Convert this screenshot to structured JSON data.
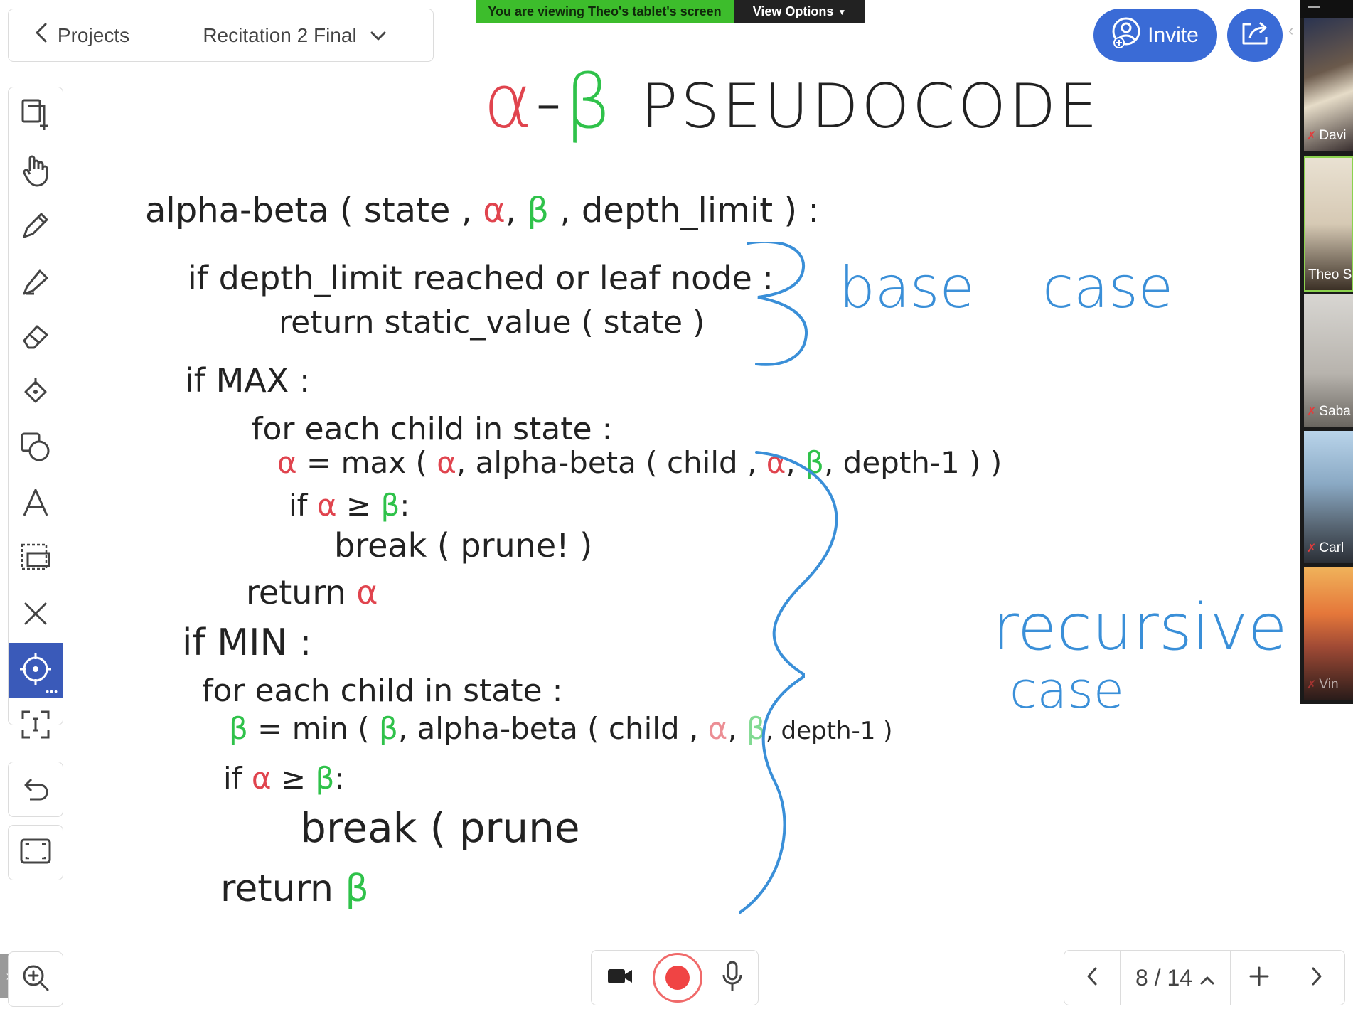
{
  "topbar": {
    "back_label": "Projects",
    "project_name": "Recitation 2 Final"
  },
  "share_banner": {
    "message": "You are viewing Theo's tablet's screen",
    "view_options": "View Options"
  },
  "header": {
    "invite_label": "Invite"
  },
  "participants": [
    {
      "name": "Davi",
      "muted": true
    },
    {
      "name": "Theo Se",
      "muted": false
    },
    {
      "name": "Saba",
      "muted": true
    },
    {
      "name": "Carl",
      "muted": true
    },
    {
      "name": "Vin",
      "muted": true
    }
  ],
  "toolbar": {
    "tools": [
      "add-page",
      "hand",
      "pencil",
      "marker",
      "eraser",
      "fill",
      "shapes",
      "text",
      "selection",
      "clear",
      "laser-pointer",
      "fit-selection"
    ],
    "active": "laser-pointer"
  },
  "pagination": {
    "indicator": "8 / 14"
  },
  "colors": {
    "accent": "#3a6bd6",
    "active_tool": "#3a5ab9",
    "banner_green": "#3dbd2c",
    "alpha_red": "#e0444e",
    "beta_green": "#2fc24a",
    "annotation_blue": "#3a8fd8",
    "record_red": "#f04444"
  },
  "board": {
    "title_alpha": "α",
    "title_dash": "-",
    "title_beta": "β",
    "title_text": "PSEUDOCODE",
    "line_signature": {
      "pre": "alpha-beta ( state ,",
      "alpha": "α",
      "comma": ",",
      "beta": "β",
      "post": ", depth_limit ) :"
    },
    "line_if_depth": "if depth_limit reached or leaf node :",
    "line_return_static": "return static_value ( state )",
    "line_if_max": "if MAX :",
    "line_for_max": "for each child in state :",
    "line_alpha_assign": {
      "alpha": "α",
      "mid": "= max (",
      "alpha2": "α",
      "mid2": ", alpha-beta ( child ,",
      "alpha3": "α",
      "dot": ",",
      "beta": "β",
      "post": ", depth-1 ) )"
    },
    "line_if_prune1": {
      "pre": "if",
      "alpha": "α",
      "ge": "≥",
      "beta": "β",
      "post": ":"
    },
    "line_break1": "break ( prune! )",
    "line_return_alpha": {
      "pre": "return",
      "alpha": "α"
    },
    "line_if_min": "if MIN :",
    "line_for_min": "for each child in state :",
    "line_beta_assign": {
      "beta": "β",
      "mid": "= min (",
      "beta2": "β",
      "mid2": ", alpha-beta ( child ,",
      "alpha": "α",
      "comma": ",",
      "beta3": "β",
      "post": ", depth-1 )"
    },
    "line_if_prune2": {
      "pre": "if",
      "alpha": "α",
      "ge": "≥",
      "beta": "β",
      "post": ":"
    },
    "line_break2": "break ( prune",
    "line_return_beta": {
      "pre": "return",
      "beta": "β"
    },
    "annotation_base": [
      "base",
      "case"
    ],
    "annotation_recursive": [
      "recursive",
      "case"
    ]
  }
}
